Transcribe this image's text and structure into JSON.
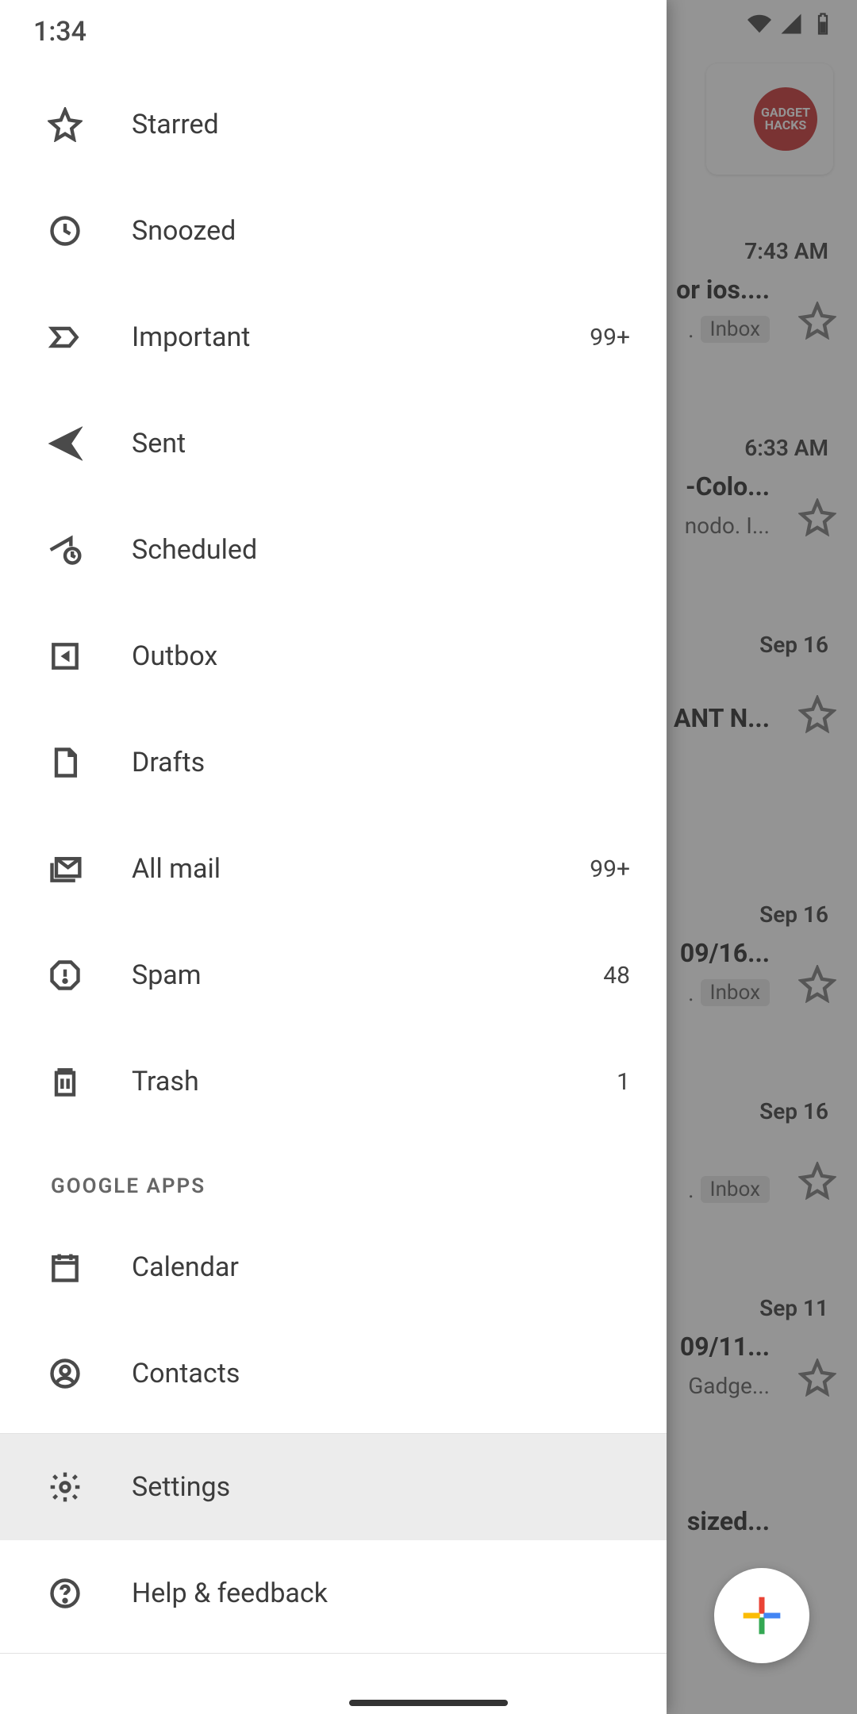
{
  "status": {
    "time": "1:34"
  },
  "drawer": {
    "items": [
      {
        "label": "Starred",
        "count": ""
      },
      {
        "label": "Snoozed",
        "count": ""
      },
      {
        "label": "Important",
        "count": "99+"
      },
      {
        "label": "Sent",
        "count": ""
      },
      {
        "label": "Scheduled",
        "count": ""
      },
      {
        "label": "Outbox",
        "count": ""
      },
      {
        "label": "Drafts",
        "count": ""
      },
      {
        "label": "All mail",
        "count": "99+"
      },
      {
        "label": "Spam",
        "count": "48"
      },
      {
        "label": "Trash",
        "count": "1"
      }
    ],
    "section_google_apps": "GOOGLE APPS",
    "apps": [
      {
        "label": "Calendar"
      },
      {
        "label": "Contacts"
      }
    ],
    "footer": [
      {
        "label": "Settings"
      },
      {
        "label": "Help & feedback"
      }
    ]
  },
  "inbox": {
    "avatar_text": "GADGET\nHACKS",
    "label_inbox": "Inbox",
    "items": [
      {
        "time": "7:43 AM",
        "subj": "or ios....",
        "snippet": ".",
        "has_label": true
      },
      {
        "time": "6:33 AM",
        "subj": "-Colo...",
        "snippet": "nodo. I...",
        "has_label": false
      },
      {
        "time": "Sep 16",
        "subj": "ANT N...",
        "snippet": "",
        "has_label": false
      },
      {
        "time": "Sep 16",
        "subj": "09/16...",
        "snippet": ".",
        "has_label": true
      },
      {
        "time": "Sep 16",
        "subj": "",
        "snippet": ".",
        "has_label": true
      },
      {
        "time": "Sep 11",
        "subj": "09/11...",
        "snippet": "Gadge...",
        "has_label": false
      },
      {
        "time": "",
        "subj": "sized...",
        "snippet": "",
        "has_label": false
      }
    ]
  }
}
